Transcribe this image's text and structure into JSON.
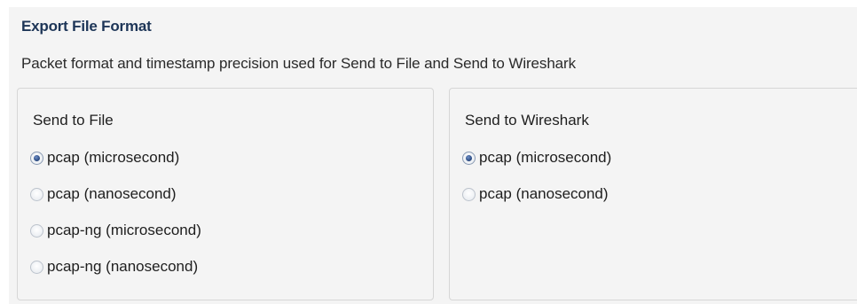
{
  "section": {
    "title": "Export File Format",
    "description": "Packet format and timestamp precision used for Send to File and Send to Wireshark"
  },
  "send_to_file": {
    "title": "Send to File",
    "options": [
      {
        "label": "pcap (microsecond)",
        "selected": true
      },
      {
        "label": "pcap (nanosecond)",
        "selected": false
      },
      {
        "label": "pcap-ng (microsecond)",
        "selected": false
      },
      {
        "label": "pcap-ng (nanosecond)",
        "selected": false
      }
    ]
  },
  "send_to_wireshark": {
    "title": "Send to Wireshark",
    "options": [
      {
        "label": "pcap (microsecond)",
        "selected": true
      },
      {
        "label": "pcap (nanosecond)",
        "selected": false
      }
    ]
  }
}
